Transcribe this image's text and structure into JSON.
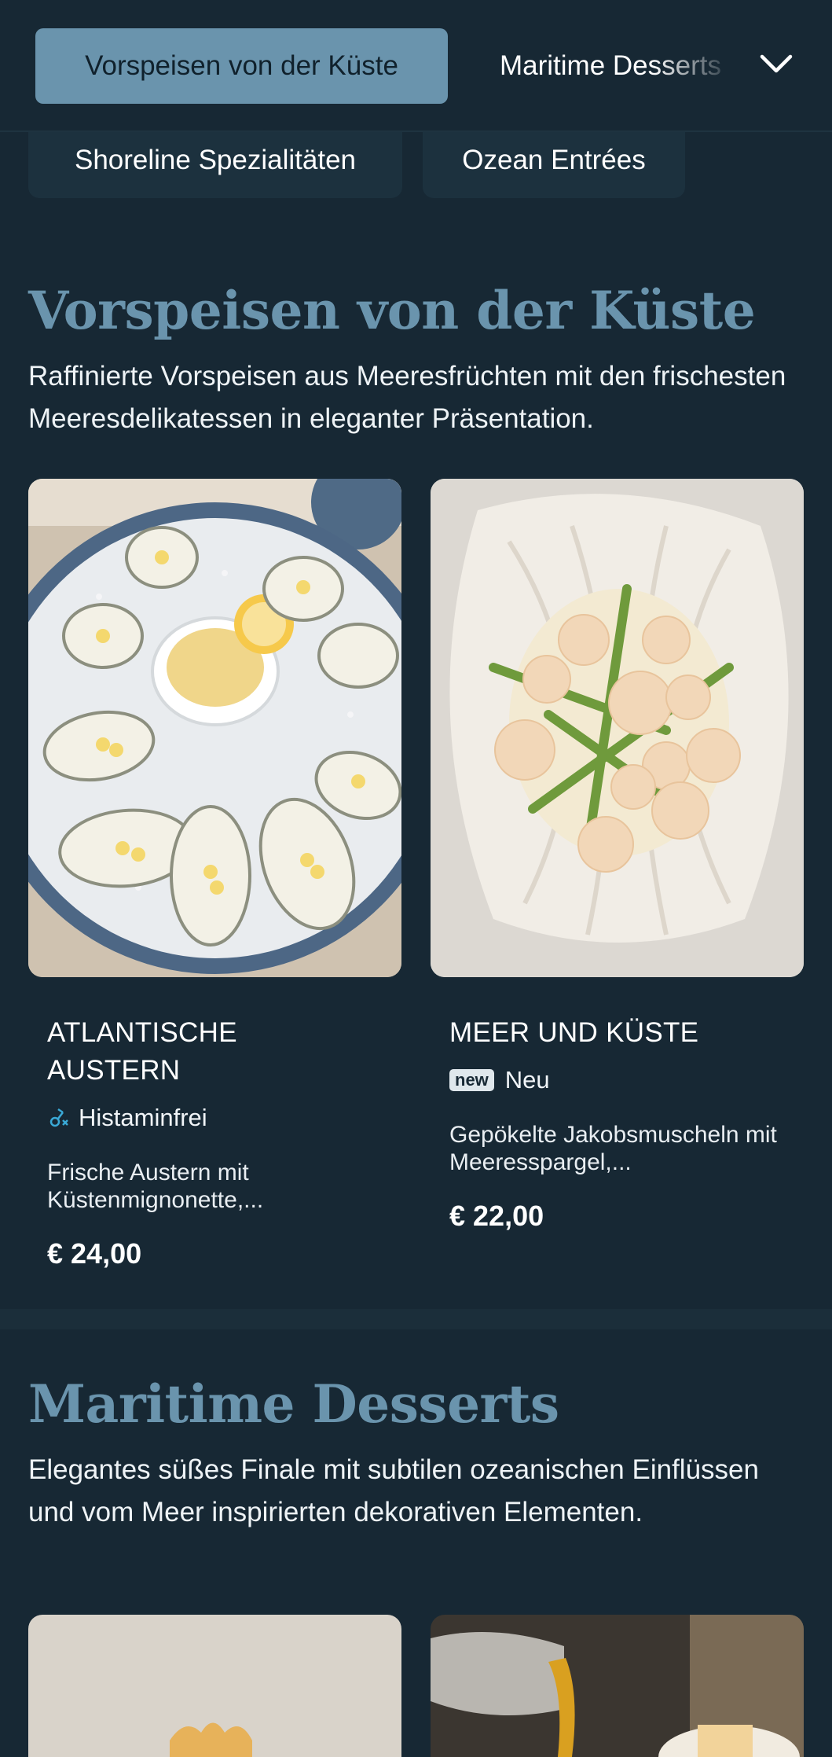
{
  "nav": {
    "active_tab": "Vorspeisen von der Küste",
    "next_tab": "Maritime Desserts",
    "chips": [
      "Shoreline Spezialitäten",
      "Ozean Entrées"
    ]
  },
  "sections": [
    {
      "title": "Vorspeisen von der Küste",
      "description": "Raffinierte Vorspeisen aus Meeresfrüchten mit den frischesten Meeresdelikatessen in eleganter Präsentation.",
      "items": [
        {
          "name": "ATLANTISCHE AUSTERN",
          "tag_icon": "histamine-free-icon",
          "tag": "Histaminfrei",
          "description": "Frische Austern mit Küstenmignonette,...",
          "price": "€ 24,00"
        },
        {
          "name": "MEER UND KÜSTE",
          "badge": "new",
          "tag": "Neu",
          "description": "Gepökelte Jakobsmuscheln mit Meeresspargel,...",
          "price": "€ 22,00"
        }
      ]
    },
    {
      "title": "Maritime Desserts",
      "description": "Elegantes süßes Finale mit subtilen ozeanischen Einflüssen und vom Meer inspirierten dekorativen Elementen."
    }
  ],
  "colors": {
    "background": "#172834",
    "accent": "#6a94ad",
    "tag_icon": "#3aa9d6"
  }
}
